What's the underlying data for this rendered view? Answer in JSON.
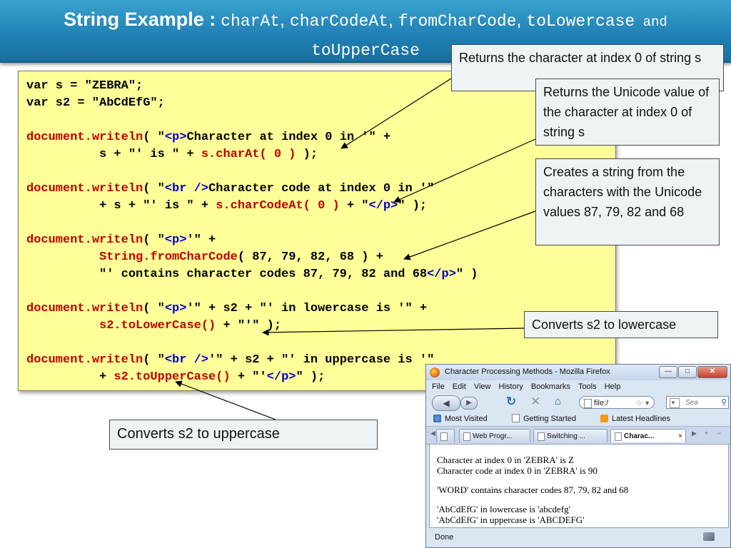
{
  "title": {
    "bold": "String Example :",
    "parts": [
      "charAt",
      ", ",
      "charCodeAt",
      ", ",
      "fromCharCode",
      ", ",
      "toLowercase",
      " and ",
      "toUpperCase"
    ]
  },
  "code": {
    "l1": "var s = \"ZEBRA\";",
    "l2": "var s2 = \"AbCdEfG\";",
    "l3a": "document.writeln",
    "l3b": "( \"",
    "l3c": "<p>",
    "l3d": "Character at index 0 in '\" +",
    "l4a": "          s + \"' is \" + ",
    "l4b": "s.charAt( 0 )",
    "l4c": " );",
    "l5a": "document.writeln",
    "l5b": "( \"",
    "l5c": "<br />",
    "l5d": "Character code at index 0 in '\"",
    "l6a": "          + s + \"' is \" + ",
    "l6b": "s.charCodeAt( 0 )",
    "l6c": " + \"",
    "l6d": "</p>",
    "l6e": "\" );",
    "l7a": "document.writeln",
    "l7b": "( \"",
    "l7c": "<p>",
    "l7d": "'\" +",
    "l8a": "          ",
    "l8b": "String.fromCharCode",
    "l8c": "( 87, 79, 82, 68 ) +",
    "l9a": "          \"' contains character codes 87, 79, 82 and 68",
    "l9b": "</p>",
    "l9c": "\" )",
    "l10a": "document.writeln",
    "l10b": "( \"",
    "l10c": "<p>",
    "l10d": "'\" + s2 + \"' in lowercase is '\" +",
    "l11a": "          ",
    "l11b": "s2.toLowerCase()",
    "l11c": " + \"'\" );",
    "l12a": "document.writeln",
    "l12b": "( \"",
    "l12c": "<br />",
    "l12d": "'\" + s2 + \"' in uppercase is '\"",
    "l13a": "          + ",
    "l13b": "s2.toUpperCase()",
    "l13c": " + \"'",
    "l13d": "</p>",
    "l13e": "\" );"
  },
  "callouts": {
    "charAt": "Returns the character at index 0 of string s",
    "charCodeAt": "Returns the Unicode value of the character at index 0 of string s",
    "fromCharCode": "Creates a string from the characters with the Unicode values 87, 79, 82 and 68",
    "toLowerCase": "Converts s2 to lowercase",
    "toUpperCase": "Converts s2 to uppercase"
  },
  "browser": {
    "window_title": "Character Processing Methods - Mozilla Firefox",
    "menu": [
      "File",
      "Edit",
      "View",
      "History",
      "Bookmarks",
      "Tools",
      "Help"
    ],
    "url": "file:/",
    "search_placeholder": "Sea",
    "bookmarks": [
      "Most Visited",
      "Getting Started",
      "Latest Headlines"
    ],
    "tabs": [
      "...",
      "Web Progr...",
      "Switching ...",
      "Charac..."
    ],
    "tab_close": "×",
    "output": [
      "Character at index 0 in 'ZEBRA' is Z",
      "Character code at index 0 in 'ZEBRA' is 90",
      "'WORD' contains character codes 87, 79, 82 and 68",
      "'AbCdEfG' in lowercase is 'abcdefg'",
      "'AbCdEfG' in uppercase is 'ABCDEFG'"
    ],
    "status": "Done"
  },
  "colors": {
    "banner": "#1f7fb3",
    "code_bg": "#ffff99",
    "method_red": "#c00000",
    "tag_blue": "#0000cc",
    "callout_bg": "#eef4f6"
  }
}
